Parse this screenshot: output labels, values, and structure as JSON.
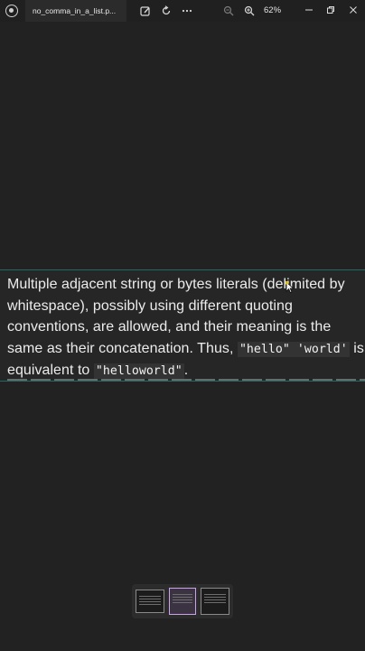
{
  "window": {
    "tab_title": "no_comma_in_a_list.p...",
    "zoom_level": "62%"
  },
  "icons": {
    "app": "app-icon",
    "annotate": "draw-icon",
    "rotate": "rotate-icon",
    "more": "more-icon",
    "zoom_out": "zoom-out-icon",
    "zoom_in": "zoom-in-icon",
    "minimize": "minimize-icon",
    "restore": "restore-icon",
    "close": "close-icon"
  },
  "page": {
    "text_before_code1": "Multiple adjacent string or bytes literals (delimited by whitespace), possibly using different quoting conventions, are allowed, and their meaning is the same as their concatenation. Thus, ",
    "code1": "\"hello\" 'world'",
    "text_between": " is equivalent to ",
    "code2": "\"helloworld\"",
    "text_after": "."
  },
  "colors": {
    "accent": "#1f6b62",
    "thumb_active": "#c9a2e8",
    "cursor": "#f0d21e"
  }
}
